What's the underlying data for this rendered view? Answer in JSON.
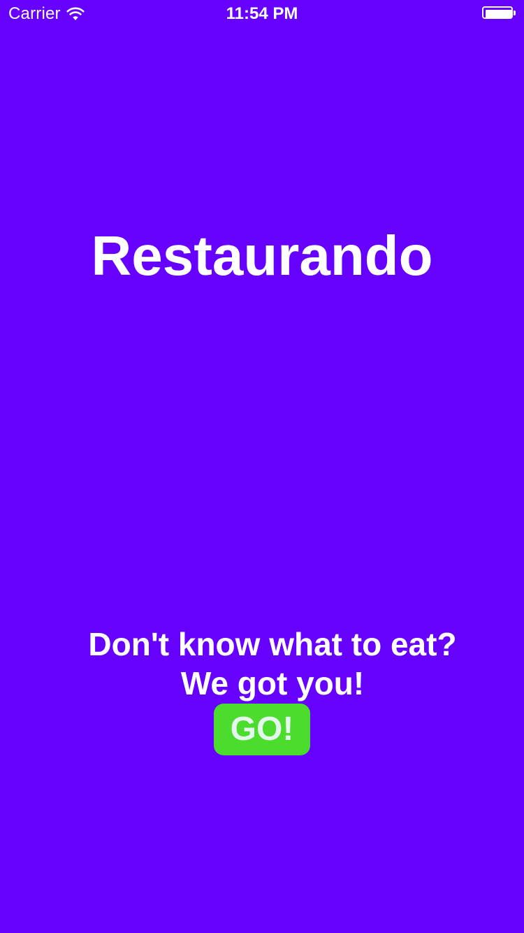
{
  "status_bar": {
    "carrier": "Carrier",
    "time": "11:54 PM",
    "wifi_icon": "wifi-icon",
    "battery_icon": "battery-icon",
    "battery_level": 1.0
  },
  "main": {
    "title": "Restaurando",
    "tagline_line1": "Don't know what to eat?",
    "tagline_line2": "We got you!",
    "go_label": "GO!"
  },
  "colors": {
    "background": "#6600ff",
    "go_button": "#4cdc2e",
    "text": "#ffffff"
  }
}
